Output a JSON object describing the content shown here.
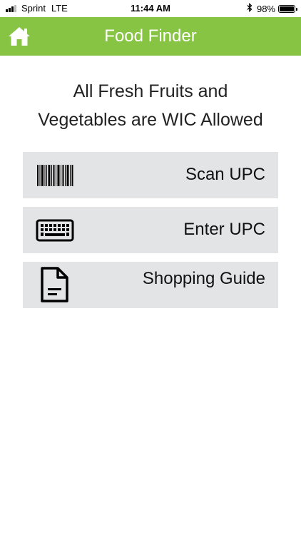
{
  "status_bar": {
    "carrier": "Sprint",
    "network": "LTE",
    "time": "11:44 AM",
    "battery_percent": "98%",
    "battery_level": 0.98,
    "signal_bars": 3,
    "signal_total": 4
  },
  "header": {
    "title": "Food Finder",
    "home_icon": "home-icon",
    "background_color": "#88c443"
  },
  "notice": {
    "line1": "All Fresh Fruits and",
    "line2": "Vegetables are WIC Allowed"
  },
  "menu": {
    "items": [
      {
        "label": "Scan UPC",
        "icon": "barcode-icon"
      },
      {
        "label": "Enter UPC",
        "icon": "keyboard-icon"
      },
      {
        "label": "Shopping Guide",
        "icon": "document-icon"
      }
    ]
  }
}
